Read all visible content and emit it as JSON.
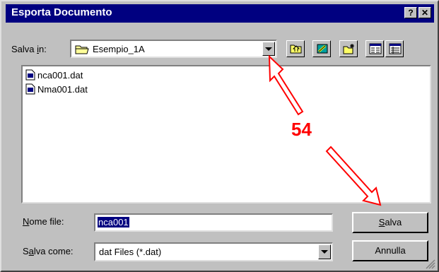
{
  "window": {
    "title": "Esporta Documento",
    "help_label": "?",
    "close_label": "✕"
  },
  "save_in": {
    "label_pre": "Salva ",
    "label_ul": "i",
    "label_post": "n:",
    "value": "Esempio_1A"
  },
  "toolbar": {
    "icons": [
      "up-folder-icon",
      "new-folder-icon",
      "create-folder-icon",
      "list-view-icon",
      "details-view-icon"
    ]
  },
  "files": [
    {
      "name": "nca001.dat"
    },
    {
      "name": "Nma001.dat"
    }
  ],
  "filename": {
    "label_ul": "N",
    "label_rest": "ome file:",
    "value": "nca001"
  },
  "filetype": {
    "label_pre": "S",
    "label_ul": "a",
    "label_rest": "lva come:",
    "value": "dat Files (*.dat)"
  },
  "buttons": {
    "save_ul": "S",
    "save_rest": "alva",
    "cancel": "Annulla"
  },
  "annotation": {
    "number": "54",
    "color": "#ff0000"
  }
}
